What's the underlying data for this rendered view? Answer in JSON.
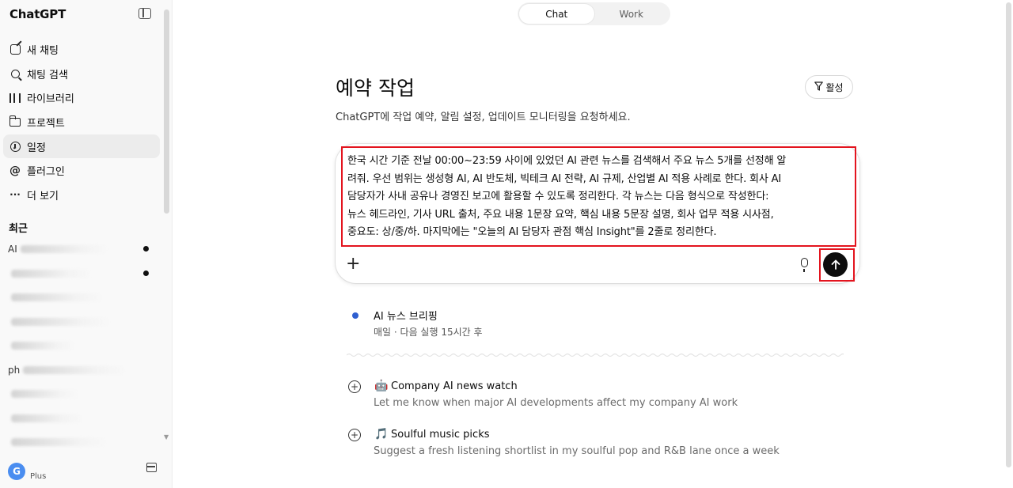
{
  "sidebar": {
    "brand": "ChatGPT",
    "nav": [
      {
        "label": "새 채팅",
        "icon": "new-chat-icon"
      },
      {
        "label": "채팅 검색",
        "icon": "search-icon"
      },
      {
        "label": "라이브러리",
        "icon": "library-icon"
      },
      {
        "label": "프로젝트",
        "icon": "folder-icon"
      },
      {
        "label": "일정",
        "icon": "clock-icon",
        "active": true
      },
      {
        "label": "플러그인",
        "icon": "at-icon"
      },
      {
        "label": "더 보기",
        "icon": "more-icon"
      }
    ],
    "recent_heading": "최근",
    "recent_prefixes": [
      "AI",
      "",
      "",
      "",
      "",
      "ph",
      "",
      "",
      "",
      ""
    ],
    "plan": "Plus",
    "avatar_initial": "G"
  },
  "mode_toggle": {
    "chat": "Chat",
    "work": "Work"
  },
  "main": {
    "title": "예약 작업",
    "filter_label": "활성",
    "subtitle": "ChatGPT에 작업 예약, 알림 설정, 업데이트 모니터링을 요청하세요.",
    "prompt_lines": [
      "한국 시간 기준 전날 00:00~23:59 사이에 있었던 AI 관련 뉴스를 검색해서 주요 뉴스 5개를 선정해 알",
      "려줘. 우선 범위는 생성형 AI, AI 반도체, 빅테크 AI 전략, AI 규제, 산업별 AI 적용 사례로 한다. 회사 AI",
      "담당자가 사내 공유나 경영진 보고에 활용할 수 있도록 정리한다. 각 뉴스는 다음 형식으로 작성한다:",
      "뉴스 헤드라인, 기사 URL 출처, 주요 내용 1문장 요약, 핵심 내용 5문장 설명, 회사 업무 적용 시사점,",
      "중요도: 상/중/하. 마지막에는 \"오늘의 AI 담당자 관점 핵심 Insight\"를 2줄로 정리한다."
    ],
    "active_task": {
      "name": "AI 뉴스 브리핑",
      "meta": "매일 · 다음 실행 15시간 후"
    },
    "suggestions": [
      {
        "emoji": "🤖",
        "title": "Company AI news watch",
        "desc": "Let me know when major AI developments affect my company AI work"
      },
      {
        "emoji": "🎵",
        "title": "Soulful music picks",
        "desc": "Suggest a fresh listening shortlist in my soulful pop and R&B lane once a week"
      }
    ],
    "colors": {
      "highlight_border": "#e3141e",
      "task_dot": "#2f5fd0",
      "send_button": "#0d0d0d"
    }
  }
}
